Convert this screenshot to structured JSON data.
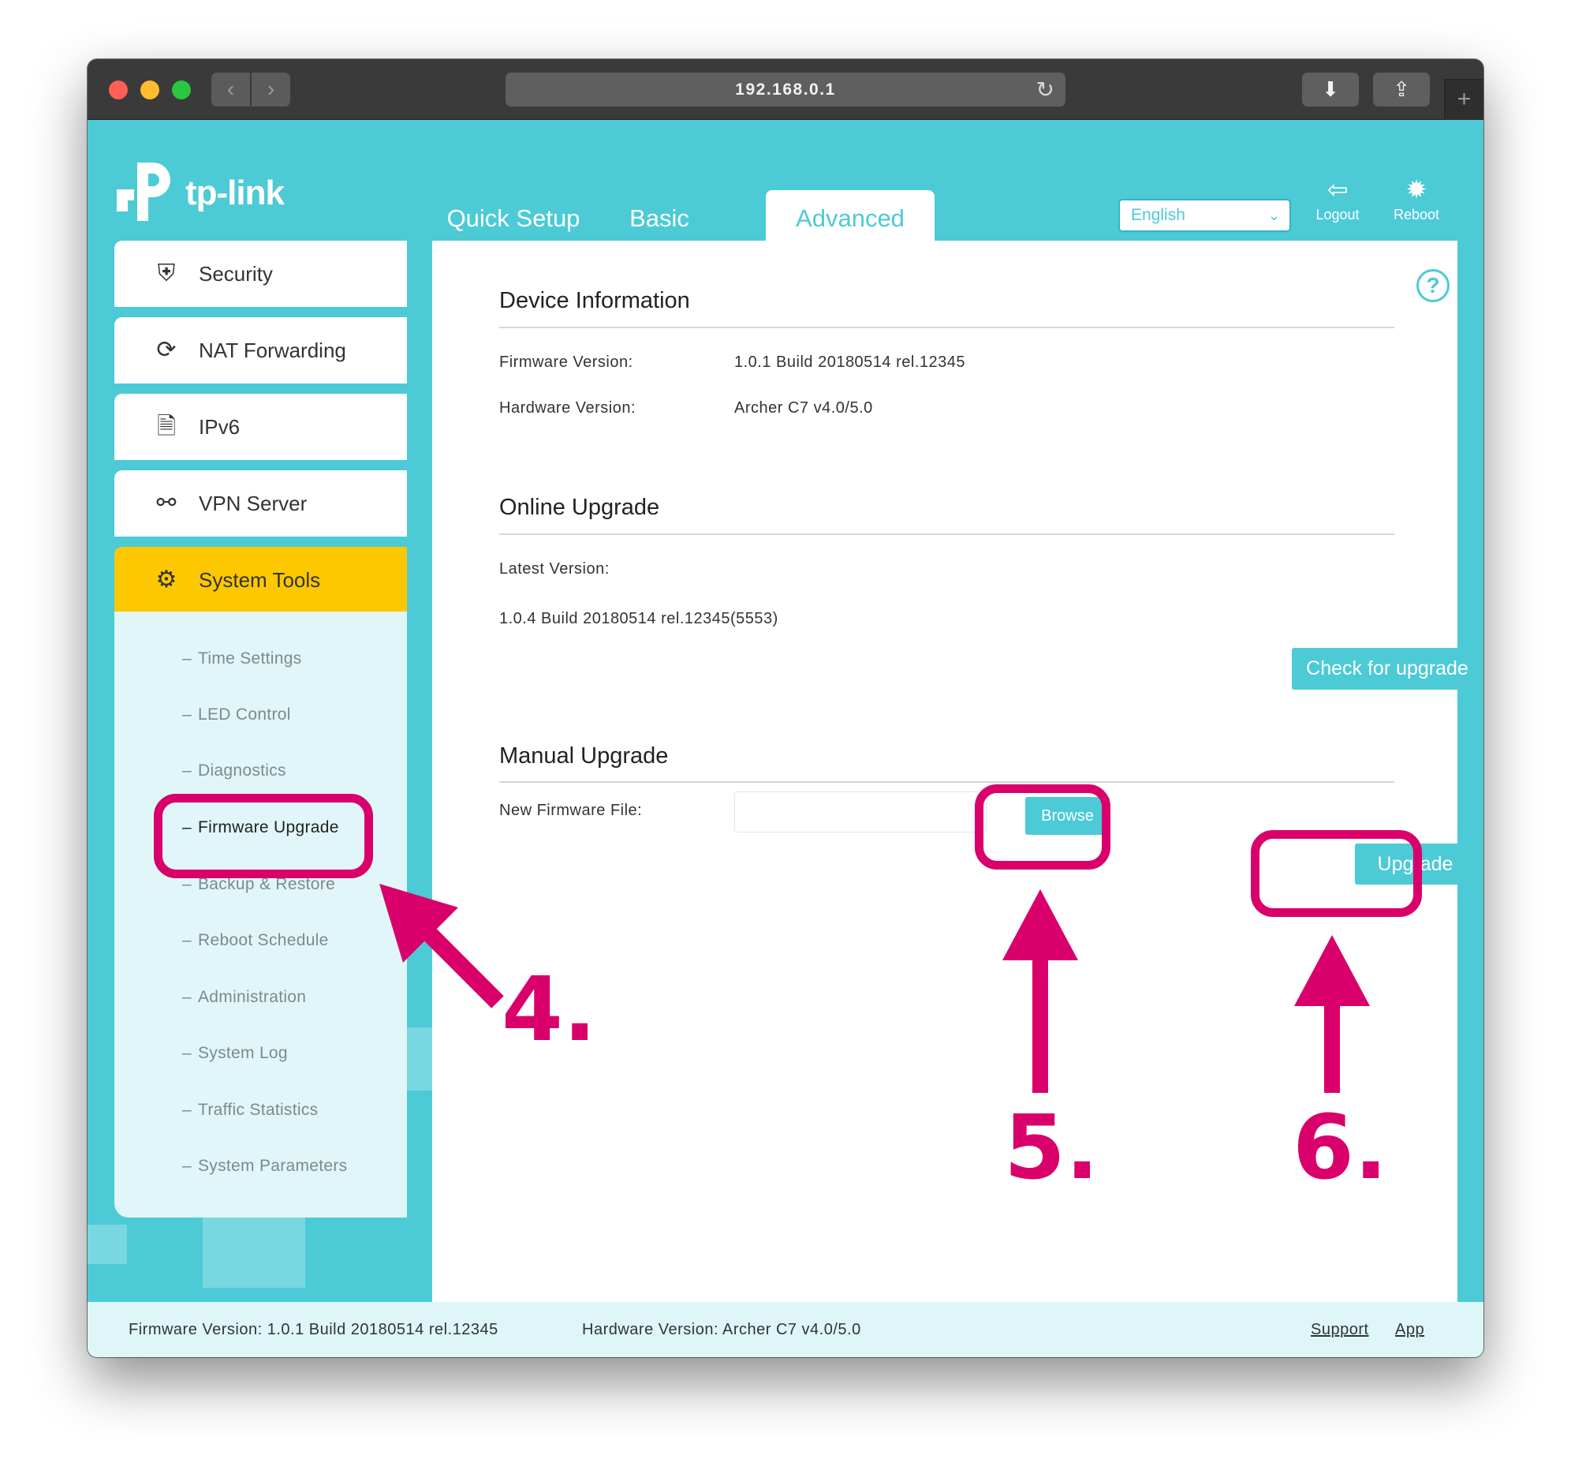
{
  "browser": {
    "url": "192.168.0.1"
  },
  "header": {
    "brand": "tp-link",
    "tabs": {
      "quick_setup": "Quick Setup",
      "basic": "Basic",
      "advanced": "Advanced"
    },
    "language": "English",
    "logout_label": "Logout",
    "reboot_label": "Reboot"
  },
  "sidebar": {
    "items": [
      {
        "label": "Security",
        "icon": "shield-icon"
      },
      {
        "label": "NAT Forwarding",
        "icon": "nat-refresh-icon"
      },
      {
        "label": "IPv6",
        "icon": "document-icon"
      },
      {
        "label": "VPN Server",
        "icon": "link-icon"
      },
      {
        "label": "System Tools",
        "icon": "gear-icon",
        "active": true
      }
    ],
    "subitems": [
      "Time Settings",
      "LED Control",
      "Diagnostics",
      "Firmware Upgrade",
      "Backup & Restore",
      "Reboot Schedule",
      "Administration",
      "System Log",
      "Traffic Statistics",
      "System Parameters"
    ],
    "selected_subitem": "Firmware Upgrade"
  },
  "main": {
    "device_info": {
      "title": "Device Information",
      "firmware_label": "Firmware Version:",
      "firmware_value": "1.0.1 Build 20180514 rel.12345",
      "hardware_label": "Hardware Version:",
      "hardware_value": "Archer C7 v4.0/5.0"
    },
    "online_upgrade": {
      "title": "Online Upgrade",
      "latest_label": "Latest Version:",
      "latest_value": "1.0.4 Build 20180514 rel.12345(5553)",
      "check_button": "Check for upgrade"
    },
    "manual_upgrade": {
      "title": "Manual Upgrade",
      "file_label": "New Firmware File:",
      "file_value": "",
      "browse_button": "Browse",
      "upgrade_button": "Upgrade"
    }
  },
  "footer": {
    "firmware": "Firmware Version: 1.0.1 Build 20180514 rel.12345",
    "hardware": "Hardware Version: Archer C7 v4.0/5.0",
    "support": "Support",
    "app": "App"
  },
  "annotations": {
    "step4": "4.",
    "step5": "5.",
    "step6": "6.",
    "color": "#d9006b"
  },
  "colors": {
    "brand_teal": "#4ccad6",
    "active_menu": "#fdc801",
    "submenu_bg": "#e1f6f8"
  }
}
